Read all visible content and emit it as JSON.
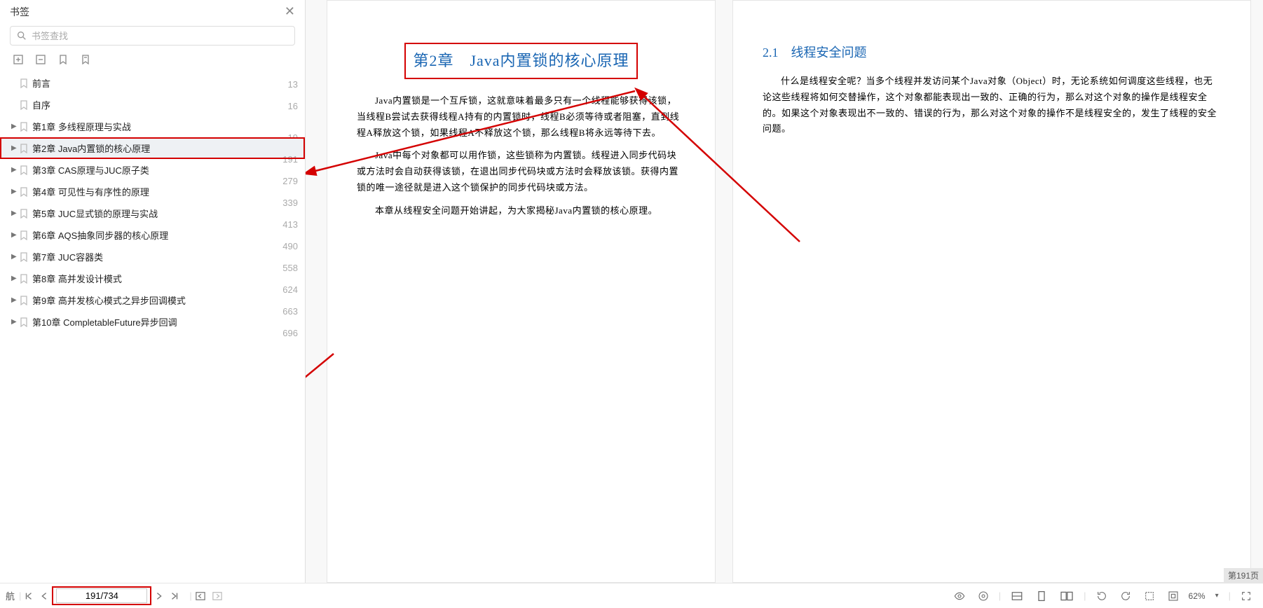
{
  "sidebar": {
    "title": "书签",
    "search_placeholder": "书签查找",
    "items": [
      {
        "label": "前言",
        "page": "13",
        "expandable": false
      },
      {
        "label": "自序",
        "page": "16",
        "expandable": false
      },
      {
        "label": "第1章 多线程原理与实战",
        "page": "19",
        "expandable": true
      },
      {
        "label": "第2章 Java内置锁的核心原理",
        "page": "191",
        "expandable": true,
        "selected": true,
        "highlight": true
      },
      {
        "label": "第3章 CAS原理与JUC原子类",
        "page": "279",
        "expandable": true
      },
      {
        "label": "第4章 可见性与有序性的原理",
        "page": "339",
        "expandable": true
      },
      {
        "label": "第5章 JUC显式锁的原理与实战",
        "page": "413",
        "expandable": true
      },
      {
        "label": "第6章 AQS抽象同步器的核心原理",
        "page": "490",
        "expandable": true
      },
      {
        "label": "第7章 JUC容器类",
        "page": "558",
        "expandable": true
      },
      {
        "label": "第8章 高并发设计模式",
        "page": "624",
        "expandable": true
      },
      {
        "label": "第9章 高并发核心模式之异步回调模式",
        "page": "663",
        "expandable": true
      },
      {
        "label": "第10章 CompletableFuture异步回调",
        "page": "696",
        "expandable": true
      }
    ]
  },
  "doc": {
    "left_page": {
      "chapter_title": "第2章　Java内置锁的核心原理",
      "p1": "Java内置锁是一个互斥锁，这就意味着最多只有一个线程能够获得该锁，当线程B尝试去获得线程A持有的内置锁时，线程B必须等待或者阻塞，直到线程A释放这个锁，如果线程A不释放这个锁，那么线程B将永远等待下去。",
      "p2": "Java中每个对象都可以用作锁，这些锁称为内置锁。线程进入同步代码块或方法时会自动获得该锁，在退出同步代码块或方法时会释放该锁。获得内置锁的唯一途径就是进入这个锁保护的同步代码块或方法。",
      "p3": "本章从线程安全问题开始讲起，为大家揭秘Java内置锁的核心原理。"
    },
    "right_page": {
      "section_title": "2.1　线程安全问题",
      "p1": "什么是线程安全呢？当多个线程并发访问某个Java对象（Object）时，无论系统如何调度这些线程，也无论这些线程将如何交替操作，这个对象都能表现出一致的、正确的行为，那么对这个对象的操作是线程安全的。如果这个对象表现出不一致的、错误的行为，那么对这个对象的操作不是线程安全的，发生了线程的安全问题。"
    },
    "page_label": "第191页"
  },
  "bottombar": {
    "nav_label": "航",
    "page_counter": "191/734",
    "zoom": "62%"
  }
}
